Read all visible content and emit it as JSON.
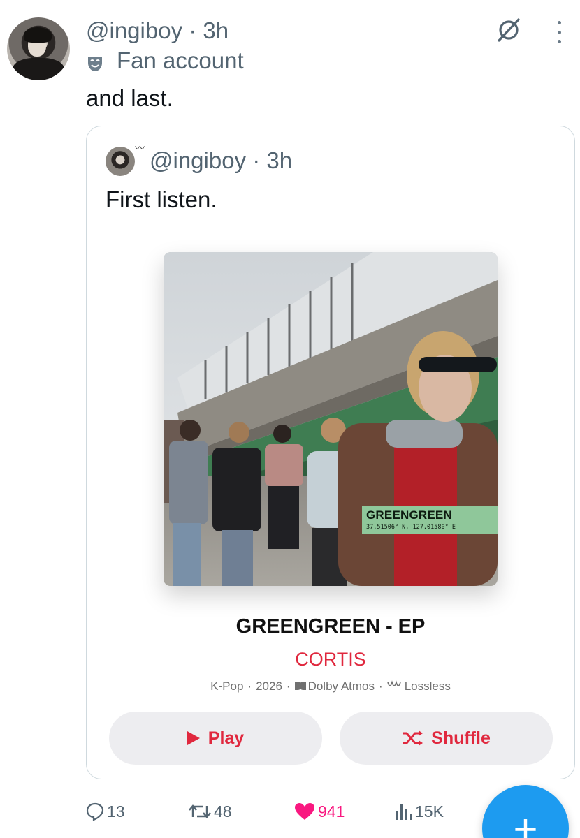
{
  "post": {
    "handle_line": "@ingiboy · 3h",
    "badge_icon": "theater-mask-icon",
    "badge_text": "Fan account",
    "text": "and last."
  },
  "quote": {
    "handle_line": "@ingiboy · 3h",
    "text": "First listen.",
    "album": {
      "cover_title": "GREENGREEN",
      "cover_coords": "37.51506° N, 127.01580° E",
      "title": "GREENGREEN - EP",
      "artist": "CORTIS",
      "meta": {
        "genre": "K-Pop",
        "year": "2026",
        "dolby": "Dolby Atmos",
        "lossless": "Lossless"
      },
      "play_label": "Play",
      "shuffle_label": "Shuffle"
    }
  },
  "actions": {
    "replies": "13",
    "reposts": "48",
    "likes": "941",
    "views": "15K"
  },
  "fab": {
    "label": "+"
  },
  "colors": {
    "accent_blue": "#1d9bf0",
    "apple_red": "#e0283e",
    "like_pink": "#f91880",
    "muted": "#536471"
  }
}
